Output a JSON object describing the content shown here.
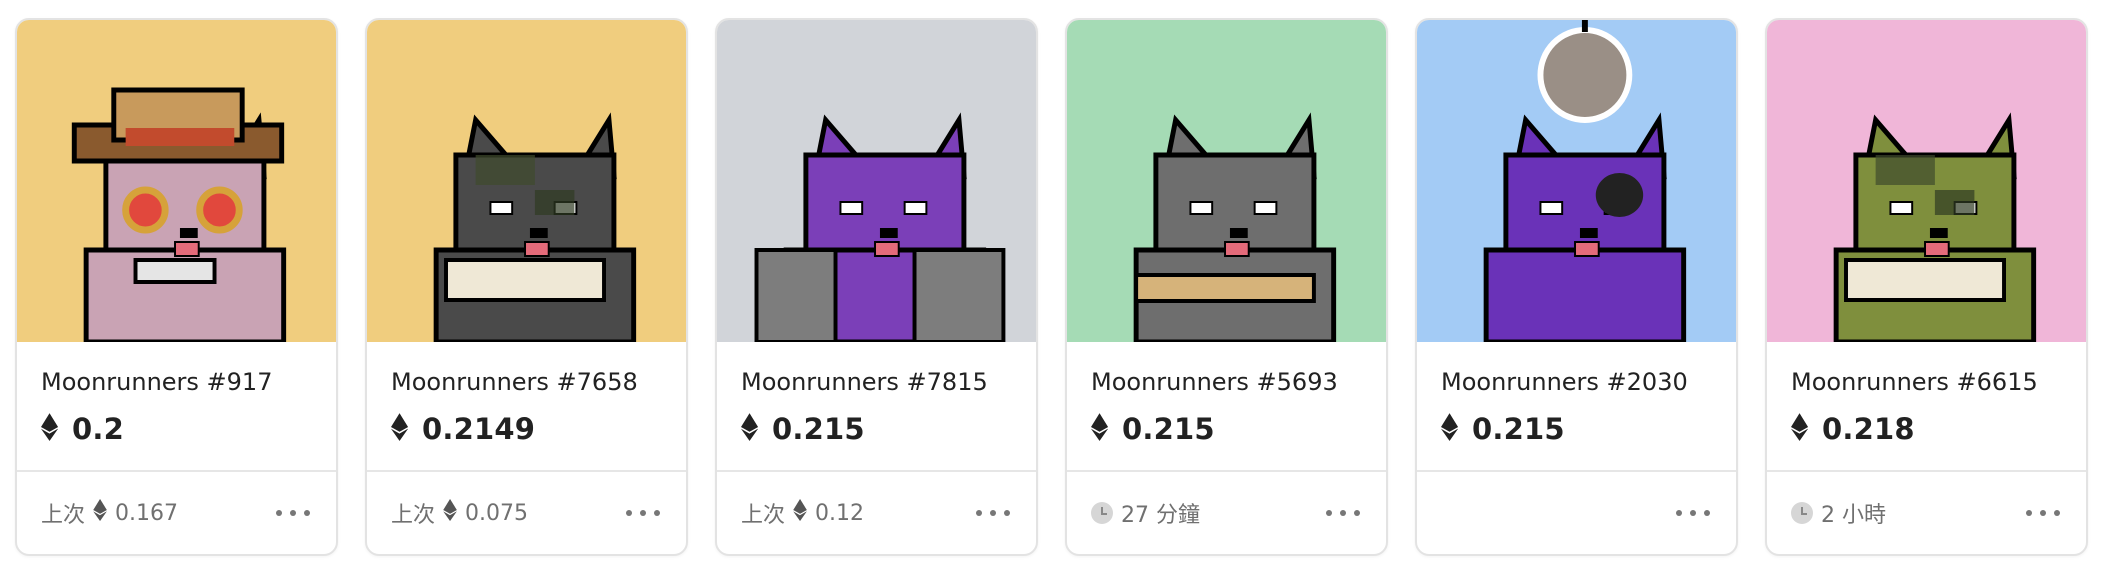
{
  "cards": [
    {
      "name": "Moonrunners #917",
      "price": "0.2",
      "footer_type": "last_sale",
      "last_label": "上次",
      "last_value": "0.167",
      "bg": "#f0cd7e",
      "fur": "#c9a3b4",
      "accessory": "cowboy-hat-glasses"
    },
    {
      "name": "Moonrunners #7658",
      "price": "0.2149",
      "footer_type": "last_sale",
      "last_label": "上次",
      "last_value": "0.075",
      "bg": "#f0cd7e",
      "fur": "#4a4a4a",
      "accessory": "camo-scarf"
    },
    {
      "name": "Moonrunners #7815",
      "price": "0.215",
      "footer_type": "last_sale",
      "last_label": "上次",
      "last_value": "0.12",
      "bg": "#d1d4d9",
      "fur": "#7b3fb8",
      "accessory": "hoodie"
    },
    {
      "name": "Moonrunners #5693",
      "price": "0.215",
      "footer_type": "time",
      "time_value": "27 分鐘",
      "bg": "#a5dbb5",
      "fur": "#6e6e6e",
      "accessory": "gold-chain"
    },
    {
      "name": "Moonrunners #2030",
      "price": "0.215",
      "footer_type": "none",
      "bg": "#a3cbf5",
      "fur": "#6a32b8",
      "accessory": "eyepatch-disco"
    },
    {
      "name": "Moonrunners #6615",
      "price": "0.218",
      "footer_type": "time",
      "time_value": "2 小時",
      "bg": "#f0b6d8",
      "fur": "#7f8f3d",
      "accessory": "camo-scarf"
    }
  ]
}
